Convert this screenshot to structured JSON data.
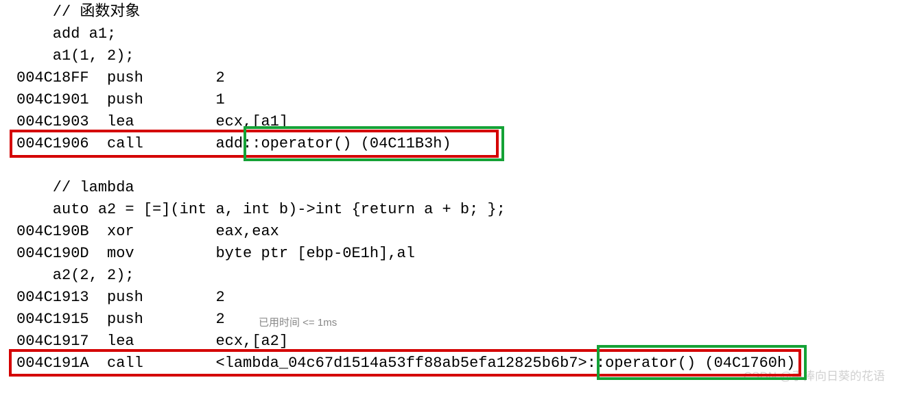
{
  "lines": {
    "l01": "    // 函数对象",
    "l02": "    add a1;",
    "l03": "    a1(1, 2);",
    "l04": "004C18FF  push        2  ",
    "l05": "004C1901  push        1  ",
    "l06": "004C1903  lea         ecx,[a1]  ",
    "l07": "004C1906  call        add::operator() (04C11B3h)  ",
    "l08": "",
    "l09": "    // lambda",
    "l10": "    auto a2 = [=](int a, int b)->int {return a + b; };",
    "l11": "004C190B  xor         eax,eax  ",
    "l12": "004C190D  mov         byte ptr [ebp-0E1h],al  ",
    "l13": "    a2(2, 2);",
    "l14": "004C1913  push        2  ",
    "l15": "004C1915  push        2  ",
    "l16": "004C1917  lea         ecx,[a2]  ",
    "l17": "004C191A  call        <lambda_04c67d1514a53ff88ab5efa12825b6b7>::operator() (04C1760h)  "
  },
  "timing_hint": "已用时间 <= 1ms",
  "watermark": "CSDN @手捧向日葵的花语",
  "highlights": {
    "functor_call_line": "004C1906  call        add::operator() (04C11B3h)",
    "functor_operator": "operator() (04C11B3h)",
    "lambda_call_line": "004C191A  call        <lambda_04c67d1514a53ff88ab5efa12825b6b7>::operator() (04C1760h)",
    "lambda_operator": "operator() (04C1760h)"
  }
}
